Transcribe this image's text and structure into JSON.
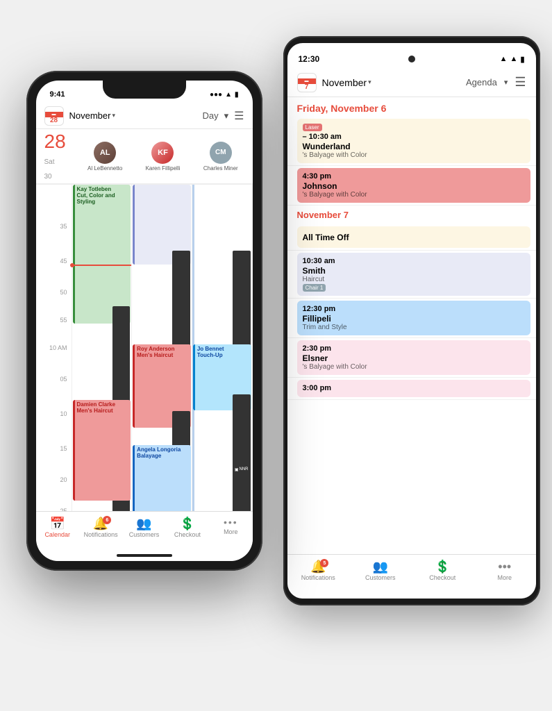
{
  "phone1": {
    "status": {
      "time": "9:41",
      "signal": "●●●",
      "wifi": "WiFi",
      "battery": "🔋"
    },
    "nav": {
      "date_num": "28",
      "month": "November",
      "view": "Day",
      "cal_top": "28"
    },
    "staff": [
      {
        "name": "Al LeBennetto",
        "initials": "AL"
      },
      {
        "name": "Karen Fillipelli",
        "initials": "KF"
      },
      {
        "name": "Charles Miner",
        "initials": "CM"
      }
    ],
    "appointments": [
      {
        "name": "Kay Totleben",
        "service": "Cut, Color and Styling",
        "color": "green",
        "staff": 0
      },
      {
        "name": "Roy Anderson",
        "service": "Men's Haircut",
        "color": "salmon",
        "staff": 1
      },
      {
        "name": "Jo Bennet",
        "service": "Touch-Up",
        "color": "blue",
        "staff": 2
      },
      {
        "name": "Damien Clarke",
        "service": "Men's Haircut",
        "color": "salmon",
        "staff": 0
      },
      {
        "name": "Angela Longoria",
        "service": "Balayage",
        "color": "blue",
        "staff": 1
      }
    ],
    "tabs": [
      {
        "label": "Calendar",
        "icon": "📅",
        "active": true
      },
      {
        "label": "Notifications",
        "icon": "🔔",
        "badge": "6",
        "active": false
      },
      {
        "label": "Customers",
        "icon": "👥",
        "active": false
      },
      {
        "label": "Checkout",
        "icon": "💲",
        "active": false
      },
      {
        "label": "More",
        "icon": "···",
        "active": false
      }
    ]
  },
  "phone2": {
    "status": {
      "time": "12:30",
      "signal": "▲",
      "wifi": "WiFi",
      "battery": "🔋"
    },
    "nav": {
      "month": "November",
      "view": "Agenda"
    },
    "date_headers": [
      "Friday, November 6",
      "November 7"
    ],
    "agenda_items": [
      {
        "time": "– 10:30 am",
        "name": "Wunderland",
        "service": "Balyage with Color",
        "tag": "Laser",
        "color": "cream"
      },
      {
        "time": "4:30 pm",
        "name": "Johnson",
        "service": "Balyage with Color",
        "color": "salmon"
      },
      {
        "time": "All Time Off",
        "name": "",
        "service": "",
        "color": "timeoff"
      },
      {
        "time": "10:30 am",
        "name": "Smith",
        "service": "Haircut",
        "tag_chair": "Chair 1",
        "color": "lavender"
      },
      {
        "time": "12:30 pm",
        "name": "Fillipeli",
        "service": "Trim and Style",
        "color": "blue"
      },
      {
        "time": "2:30 pm",
        "name": "Elsner",
        "service": "Balyage with Color",
        "color": "pink"
      },
      {
        "time": "3:00 pm",
        "name": "",
        "service": "",
        "color": "purple"
      }
    ],
    "tabs": [
      {
        "label": "Notifications",
        "icon": "🔔",
        "badge": "5",
        "active": false
      },
      {
        "label": "Customers",
        "icon": "👥",
        "active": false
      },
      {
        "label": "Checkout",
        "icon": "💲",
        "active": false
      },
      {
        "label": "More",
        "icon": "···",
        "active": false
      }
    ]
  }
}
